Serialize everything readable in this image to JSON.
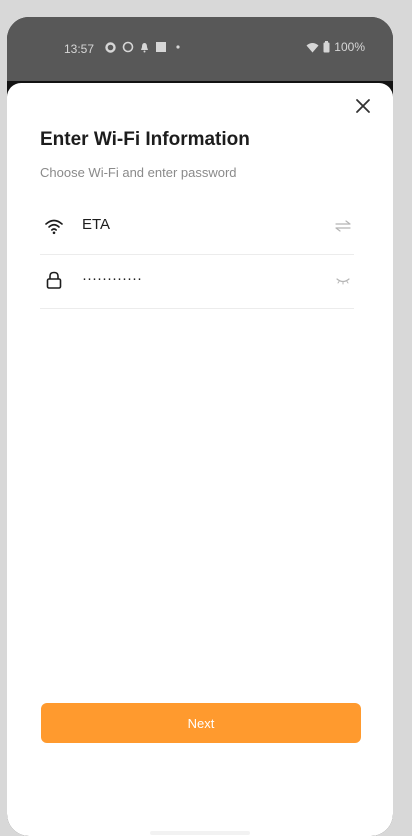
{
  "status_bar": {
    "time": "13:57",
    "battery": "100%",
    "icons_left": [
      "ring-icon",
      "circle-icon",
      "bell-icon",
      "square-icon",
      "dot-icon"
    ],
    "icons_right": [
      "wifi-icon",
      "battery-icon"
    ]
  },
  "sheet": {
    "title": "Enter Wi-Fi Information",
    "subtitle": "Choose Wi-Fi and enter password",
    "wifi_field": {
      "value": "ETA",
      "icon": "wifi-icon",
      "action_icon": "swap-icon"
    },
    "password_field": {
      "value": "············",
      "icon": "lock-icon",
      "action_icon": "eye-closed-icon"
    },
    "next_label": "Next"
  },
  "colors": {
    "accent": "#ff9a2e",
    "title": "#1d1d1d",
    "subtitle": "#8a8a8a",
    "status_bar": "#585858"
  }
}
